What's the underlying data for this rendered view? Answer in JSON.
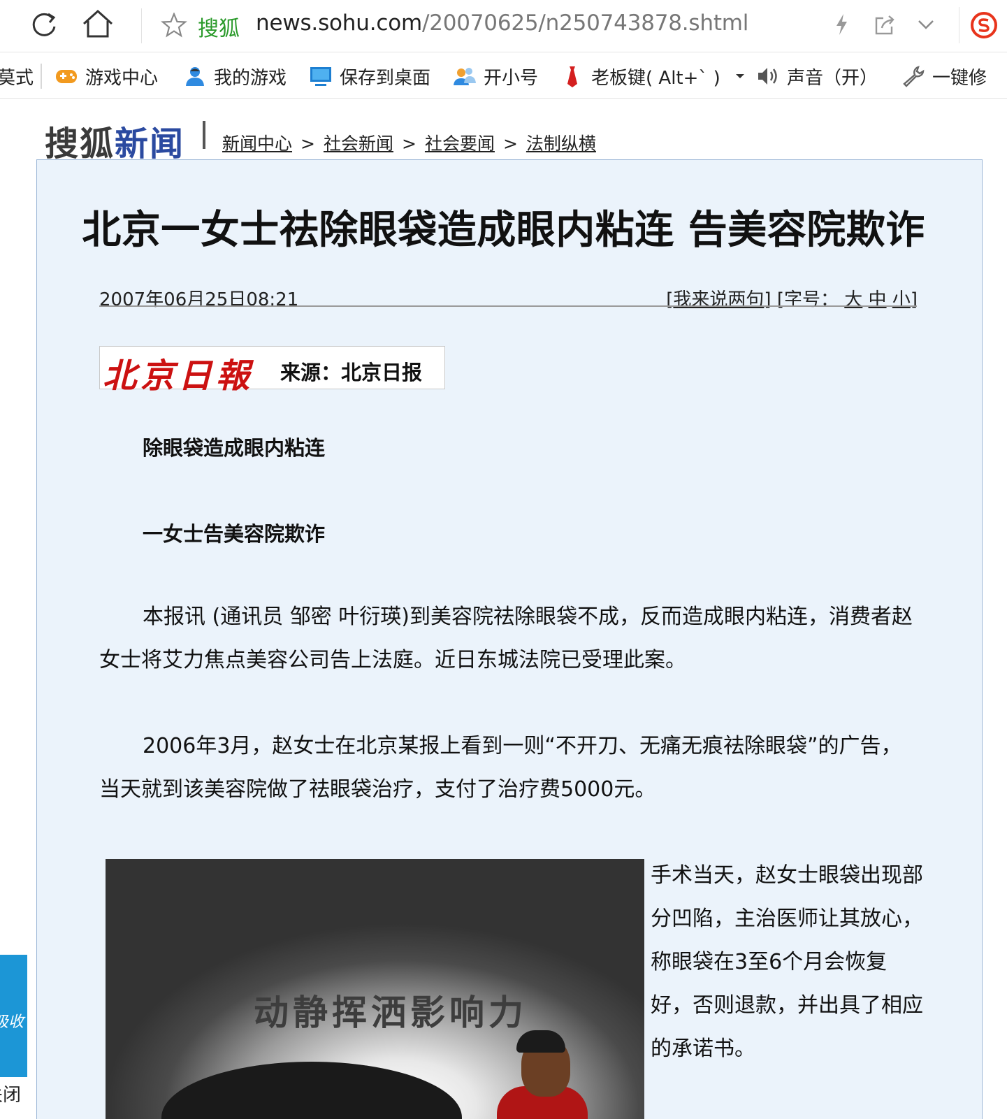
{
  "browser": {
    "site_name": "搜狐",
    "url_host": "news.sohu.com",
    "url_path": "/20070625/n250743878.shtml"
  },
  "bookmarks": {
    "partial_left": "莫式",
    "items": [
      {
        "label": "游戏中心",
        "icon": "gamepad-icon"
      },
      {
        "label": "我的游戏",
        "icon": "user-icon"
      },
      {
        "label": "保存到桌面",
        "icon": "monitor-icon"
      },
      {
        "label": "开小号",
        "icon": "users-icon"
      },
      {
        "label": "老板键( Alt+` )",
        "icon": "tie-icon"
      },
      {
        "label": "声音（开）",
        "icon": "speaker-icon"
      },
      {
        "label": "一键修",
        "icon": "wrench-icon"
      }
    ]
  },
  "header": {
    "logo_part1": "搜狐",
    "logo_part2": "新闻",
    "breadcrumb": [
      "新闻中心",
      "社会新闻",
      "社会要闻",
      "法制纵横"
    ],
    "breadcrumb_sep": ">"
  },
  "article": {
    "title": "北京一女士祛除眼袋造成眼内粘连 告美容院欺诈",
    "date": "2007年06月25日08:21",
    "comment_link": "我来说两句",
    "font_size_label": "字号：",
    "font_sizes": [
      "大",
      "中",
      "小"
    ],
    "source_logo": "北京日報",
    "source_label": "来源：北京日报",
    "subtitle1": "除眼袋造成眼内粘连",
    "subtitle2": "一女士告美容院欺诈",
    "para1": "本报讯 (通讯员 邹密 叶衍瑛)到美容院祛除眼袋不成，反而造成眼内粘连，消费者赵女士将艾力焦点美容公司告上法庭。近日东城法院已受理此案。",
    "para2": "2006年3月，赵女士在北京某报上看到一则“不开刀、无痛无痕祛除眼袋”的广告，当天就到该美容院做了祛眼袋治疗，支付了治疗费5000元。",
    "para3": "手术当天，赵女士眼袋出现部分凹陷，主治医师让其放心，称眼袋在3至6个月会恢复好，否则退款，并出具了相应的承诺书。",
    "ad_text": "动静挥洒影响力"
  },
  "left_widget": {
    "text": "吸收",
    "bottom_text": "关闭"
  }
}
